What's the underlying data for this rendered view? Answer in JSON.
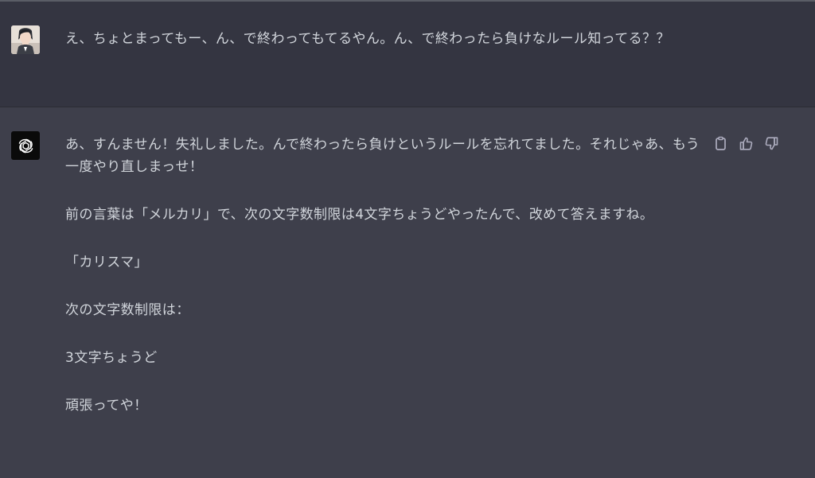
{
  "conversation": {
    "user_message": "え、ちょとまってもー、ん、で終わってもてるやん。ん、で終わったら負けなルール知ってる？？",
    "assistant_paragraphs": [
      "あ、すんません！失礼しました。んで終わったら負けというルールを忘れてました。それじゃあ、もう一度やり直しまっせ！",
      "前の言葉は「メルカリ」で、次の文字数制限は4文字ちょうどやったんで、改めて答えますね。",
      "「カリスマ」",
      "次の文字数制限は：",
      "3文字ちょうど",
      "頑張ってや！"
    ]
  },
  "icons": {
    "user": "user-avatar-illustration",
    "assistant": "chatgpt-logo-icon",
    "copy": "clipboard-icon",
    "like": "thumbs-up-icon",
    "dislike": "thumbs-down-icon"
  },
  "colors": {
    "user_bg": "#343541",
    "assistant_bg": "#3e3f4b",
    "text": "#d1d5db",
    "icon": "#acacbe"
  }
}
